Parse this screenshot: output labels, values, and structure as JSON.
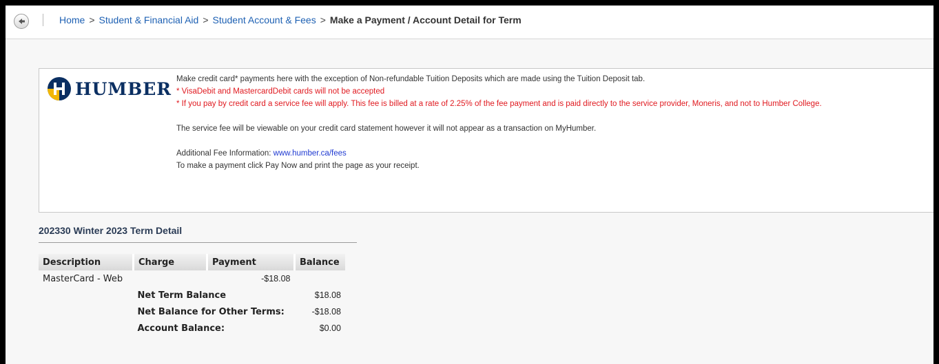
{
  "breadcrumb": {
    "items": [
      "Home",
      "Student & Financial Aid",
      "Student Account & Fees"
    ],
    "separator": ">",
    "current": "Make a Payment / Account Detail for Term"
  },
  "notice": {
    "logo_text": "HUMBER",
    "line1": "Make credit card* payments here with the exception of Non-refundable Tuition Deposits which are made using the Tuition Deposit tab.",
    "warning1": "* VisaDebit and MastercardDebit cards will not be accepted",
    "warning2": "* If you pay by credit card a service fee will apply. This fee is billed at a rate of 2.25% of the fee payment and is paid directly to the service provider, Moneris, and not to Humber College.",
    "service_fee_note": "The service fee will be viewable on your credit card statement however it will not appear as a transaction on MyHumber.",
    "additional_label": "Additional Fee Information: ",
    "fees_link": "www.humber.ca/fees",
    "pay_instruction": "To make a payment click Pay Now and print the page as your receipt."
  },
  "term": {
    "title": "202330 Winter 2023 Term Detail",
    "columns": [
      "Description",
      "Charge",
      "Payment",
      "Balance"
    ],
    "rows": [
      {
        "description": "MasterCard - Web",
        "charge": "",
        "payment": "-$18.08",
        "balance": ""
      }
    ],
    "summary": [
      {
        "label": "Net Term Balance",
        "value": "$18.08"
      },
      {
        "label": "Net Balance for Other Terms:",
        "value": "-$18.08"
      },
      {
        "label": "Account Balance:",
        "value": "$0.00"
      }
    ]
  },
  "colors": {
    "link": "#1d60b3",
    "warning": "#e0191f",
    "brand_navy": "#0b2f62",
    "brand_gold": "#f2b705"
  },
  "icons": [
    "back-arrow-icon",
    "humber-logo-icon"
  ]
}
